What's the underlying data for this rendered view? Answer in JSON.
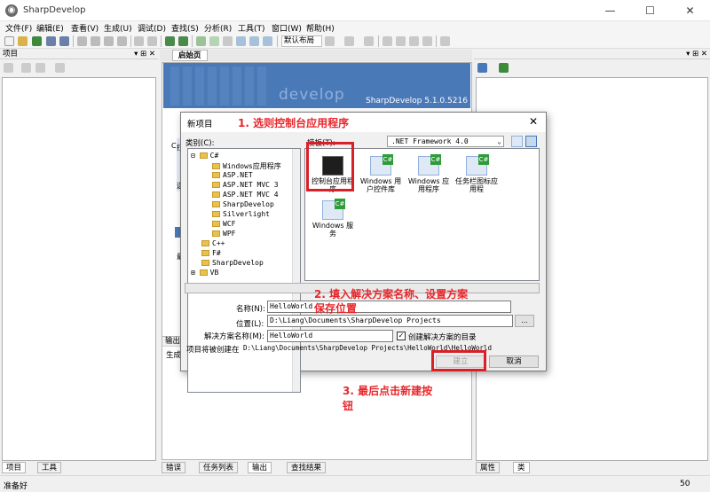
{
  "window": {
    "title": "SharpDevelop",
    "minimize": "—",
    "maximize": "☐",
    "close": "✕"
  },
  "menu": [
    "文件(F)",
    "编辑(E)",
    "查看(V)",
    "生成(U)",
    "调试(D)",
    "查找(S)",
    "分析(R)",
    "工具(T)",
    "窗口(W)",
    "帮助(H)"
  ],
  "toolbar": {
    "layout_combo": "默认布局"
  },
  "left_panel": {
    "title": "项目",
    "pin": "▾ ⊞ ✕",
    "tabs": [
      "项目",
      "工具"
    ]
  },
  "right_panel": {
    "pin": "▾ ⊞ ✕",
    "tabs": [
      "属性",
      "类"
    ]
  },
  "center": {
    "tab": "启始页",
    "banner": {
      "watermark": "develop",
      "version": "SharpDevelop 5.1.0.5216"
    },
    "behind": {
      "letter_c": "C",
      "letter_p": "拉",
      "letter_s": "选",
      "letter_b": "最",
      "output_header": "输出",
      "output_text": "生成"
    },
    "bottom_tabs": [
      "错误",
      "任务列表",
      "输出",
      "查找结果"
    ]
  },
  "dialog": {
    "title": "新项目",
    "close": "✕",
    "category_label": "类别(C):",
    "templates_label": "模板(T):",
    "framework": ".NET Framework 4.0",
    "tree": {
      "root": "C#",
      "children": [
        "Windows应用程序",
        "ASP.NET",
        "ASP.NET MVC 3",
        "ASP.NET MVC 4",
        "SharpDevelop",
        "Silverlight",
        "WCF",
        "WPF"
      ],
      "others": [
        "C++",
        "F#",
        "SharpDevelop",
        "VB"
      ]
    },
    "templates": [
      {
        "label": "控制台应用程序"
      },
      {
        "label": "Windows 用户控件库"
      },
      {
        "label": "Windows 应用程序"
      },
      {
        "label": "任务栏图标应用程"
      },
      {
        "label": "Windows 服务"
      }
    ],
    "name_label": "名称(N):",
    "name_value": "HelloWorld",
    "location_label": "位置(L):",
    "location_value": "D:\\Liang\\Documents\\SharpDevelop Projects",
    "browse": "...",
    "solution_label": "解决方案名称(M):",
    "solution_value": "HelloWorld",
    "create_dir_label": "创建解决方案的目录",
    "create_dir_checked": true,
    "path_prefix": "项目将被创建在",
    "path_value": "D:\\Liang\\Documents\\SharpDevelop Projects\\HelloWorld\\HelloWorld",
    "create_button": "建立",
    "cancel_button": "取消"
  },
  "annotations": {
    "step1": "1. 选则控制台应用程序",
    "step2_line1": "2. 填入解决方案名称、设置方案",
    "step2_line2": "保存位置",
    "step3_line1": "3.  最后点击新建按",
    "step3_line2": "钮",
    "color": "#e8262b"
  },
  "status": {
    "text": "准备好",
    "number": "50"
  }
}
